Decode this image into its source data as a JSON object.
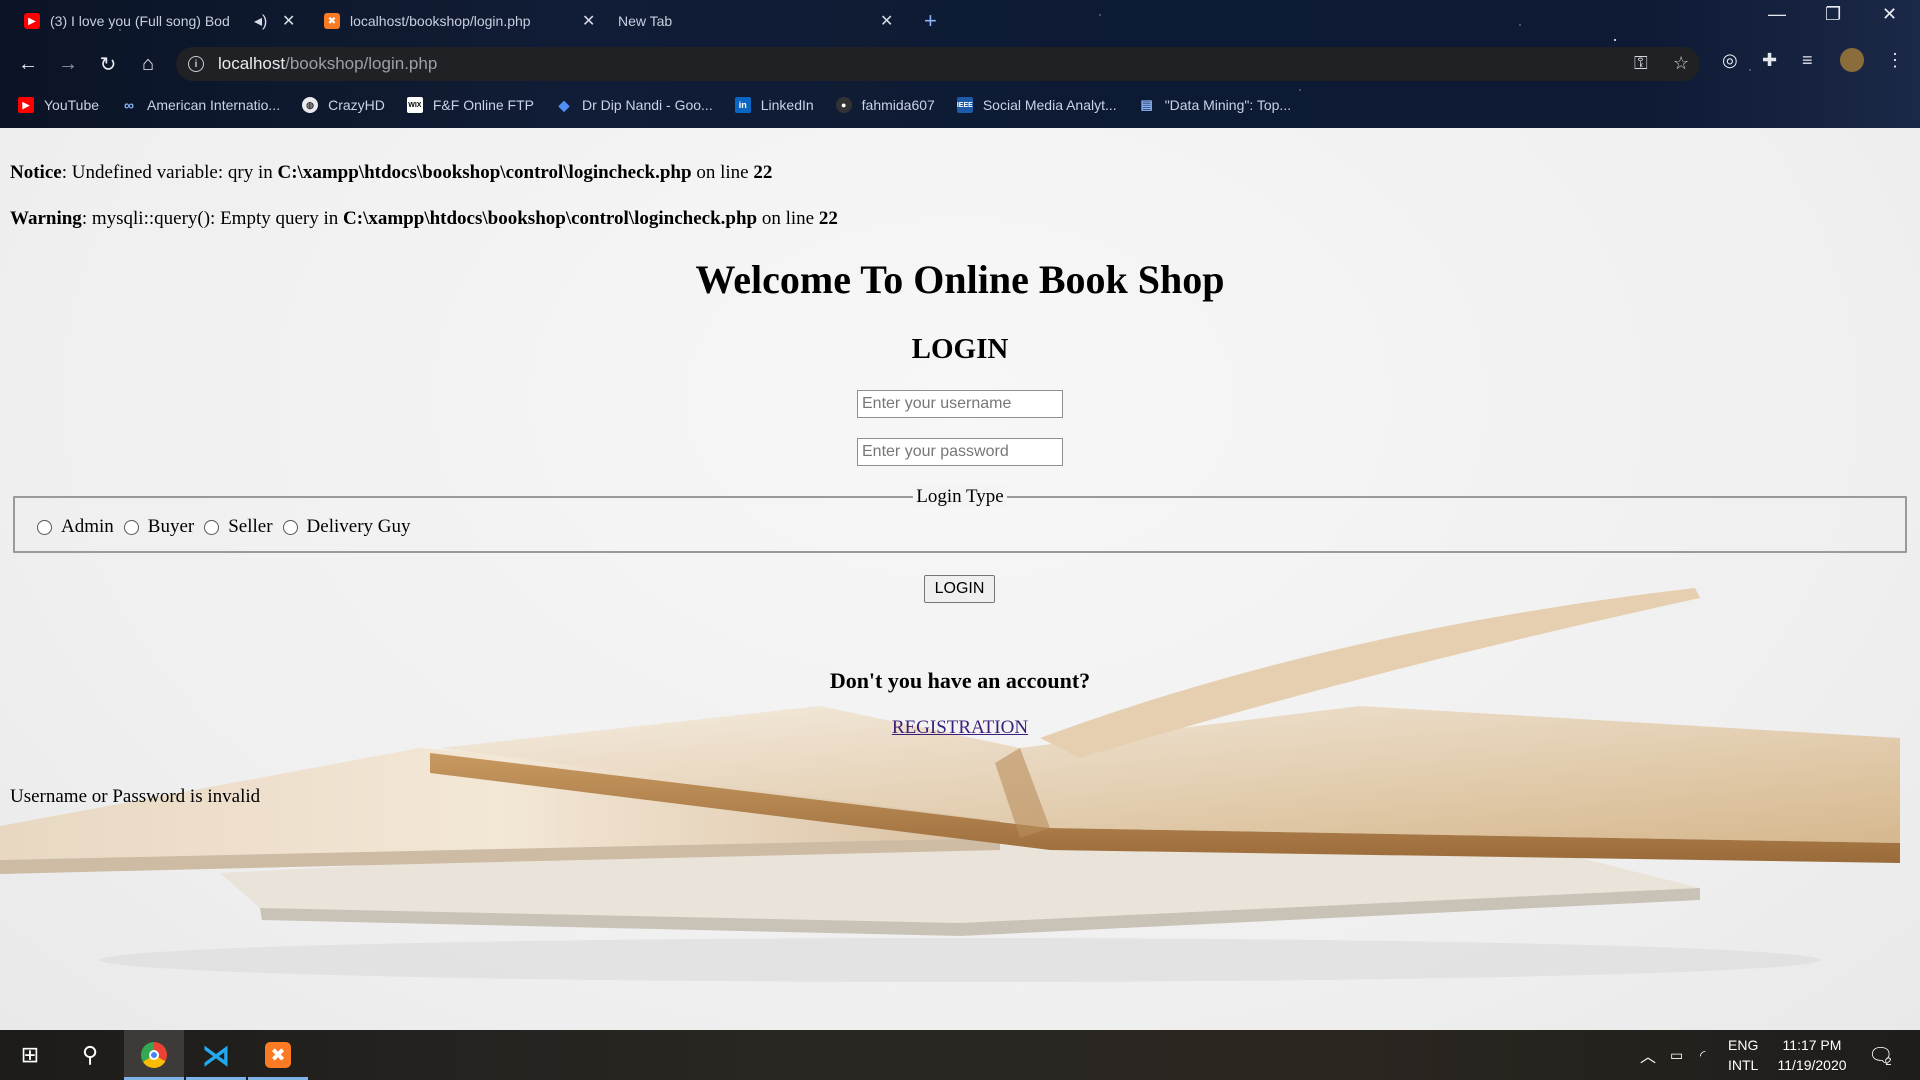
{
  "browser": {
    "tabs": [
      {
        "title": "(3) I love you (Full song) Bod",
        "favicon": "youtube-icon",
        "muted_icon": "speaker-icon"
      },
      {
        "title": "localhost/bookshop/login.php",
        "favicon": "xampp-icon"
      },
      {
        "title": "New Tab"
      }
    ],
    "new_tab": "+",
    "address": {
      "host": "localhost",
      "path": "/bookshop/login.php"
    },
    "bookmarks": [
      {
        "label": "YouTube",
        "icon": "youtube-icon",
        "color": "#ff0000"
      },
      {
        "label": "American Internatio...",
        "icon": "link-icon",
        "color": "#8ab4f8"
      },
      {
        "label": "CrazyHD",
        "icon": "globe-icon",
        "color": "#e8eaed"
      },
      {
        "label": "F&F Online FTP",
        "icon": "wix-icon",
        "color": "#ffffff"
      },
      {
        "label": "Dr Dip Nandi - Goo...",
        "icon": "graduation-cap-icon",
        "color": "#4f8ff7"
      },
      {
        "label": "LinkedIn",
        "icon": "linkedin-icon",
        "color": "#0a66c2"
      },
      {
        "label": "fahmida607",
        "icon": "github-icon",
        "color": "#333333"
      },
      {
        "label": "Social Media Analyt...",
        "icon": "ieee-icon",
        "color": "#1e5aa8"
      },
      {
        "label": "\"Data Mining\": Top...",
        "icon": "document-icon",
        "color": "#8ab4f8"
      }
    ]
  },
  "page": {
    "notice": {
      "label": "Notice",
      "text1": ": Undefined variable: qry in ",
      "file": "C:\\xampp\\htdocs\\bookshop\\control\\logincheck.php",
      "text2": " on line ",
      "line": "22"
    },
    "warning": {
      "label": "Warning",
      "text1": ": mysqli::query(): Empty query in ",
      "file": "C:\\xampp\\htdocs\\bookshop\\control\\logincheck.php",
      "text2": " on line ",
      "line": "22"
    },
    "welcome": "Welcome To Online Book Shop",
    "login_heading": "LOGIN",
    "username_placeholder": "Enter your username",
    "password_placeholder": "Enter your password",
    "login_type_legend": "Login Type",
    "login_types": [
      "Admin",
      "Buyer",
      "Seller",
      "Delivery Guy"
    ],
    "login_button": "LOGIN",
    "account_question": "Don't you have an account?",
    "registration_link": "REGISTRATION",
    "invalid_message": "Username or Password is invalid",
    "link_color": "#3b1f7a"
  },
  "taskbar": {
    "apps": [
      "windows-start-icon",
      "search-icon",
      "chrome-icon",
      "vscode-icon",
      "xampp-icon"
    ],
    "lang_top": "ENG",
    "lang_bottom": "INTL",
    "time": "11:17 PM",
    "date": "11/19/2020",
    "notification_count": "2"
  }
}
